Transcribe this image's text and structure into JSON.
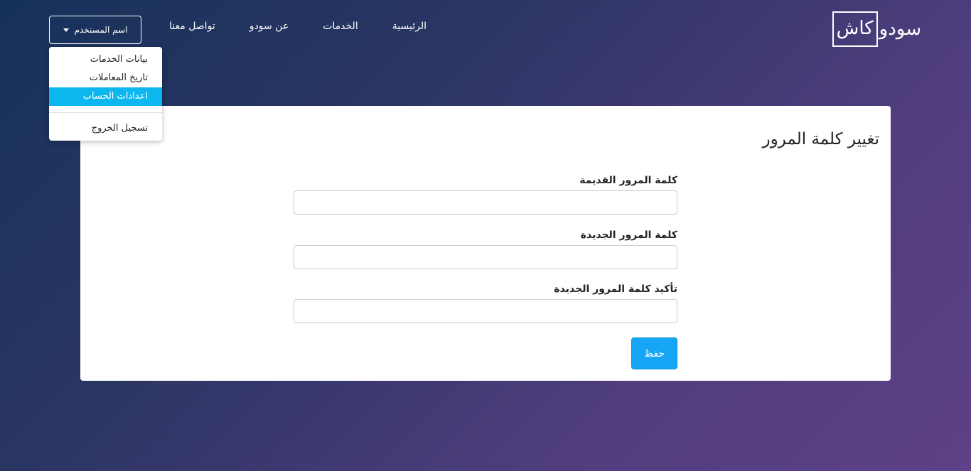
{
  "navbar": {
    "logo_part1": "سودو",
    "logo_part2": "كاش",
    "links": [
      "الرئيسية",
      "الخدمات",
      "عن سودو",
      "تواصل معنا"
    ],
    "user_button": "اسم المستخدم"
  },
  "dropdown": {
    "items": [
      "بيانات الخدمات",
      "تاريخ المعاملات",
      "اعدادات الحساب"
    ],
    "active_item": "اعدادات الحساب",
    "logout": "تسجيل الخروج"
  },
  "card": {
    "title": "تغيير كلمة المرور",
    "old_password_label": "كلمة المرور القديمة",
    "new_password_label": "كلمة المرور الجديدة",
    "confirm_password_label": "تأكيد كلمة المرور الجديدة",
    "old_password_value": "",
    "new_password_value": "",
    "confirm_password_value": "",
    "save_label": "حفظ"
  },
  "colors": {
    "accent": "#0cb6ef",
    "button": "#17a6f5",
    "background_start": "#16325a",
    "background_end": "#5e4187"
  }
}
